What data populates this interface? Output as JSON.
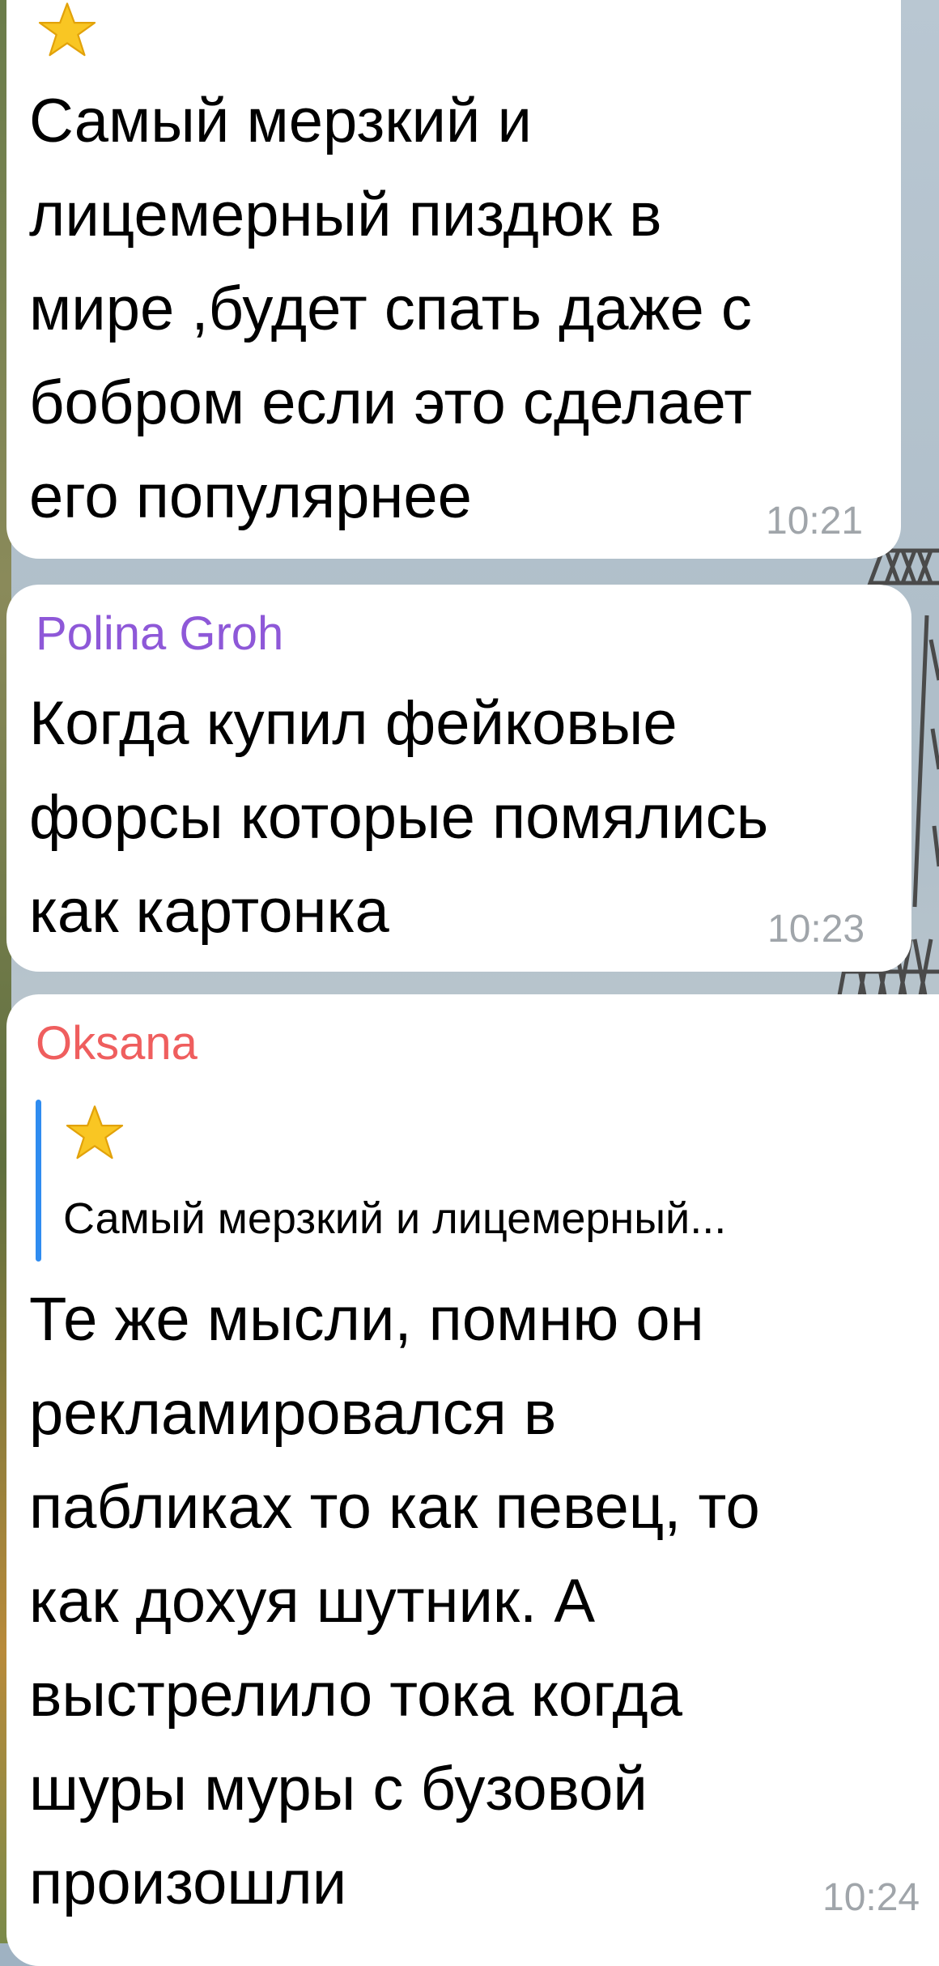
{
  "messages": [
    {
      "emoji": "star",
      "lines": [
        "Самый мерзкий и",
        "лицемерный пиздюк в",
        "мире ,будет спать даже с",
        "бобром если это сделает",
        "его популярнее"
      ],
      "time": "10:21"
    },
    {
      "sender": "Polina Groh",
      "sender_color": "#8e58d8",
      "lines": [
        "Когда купил фейковые",
        "форсы которые помялись",
        "как картонка"
      ],
      "time": "10:23"
    },
    {
      "sender": "Oksana",
      "sender_color": "#ef5e5e",
      "reply": {
        "emoji": "star",
        "text": "Самый мерзкий и лицемерный...",
        "bar_color": "#2f8cf0"
      },
      "lines": [
        "Те же мысли, помню он",
        "рекламировался в",
        "пабликах то как певец, то",
        "как дохуя шутник. А",
        "выстрелило тока когда",
        "шуры муры с бузовой",
        "произошли"
      ],
      "time": "10:24"
    }
  ]
}
